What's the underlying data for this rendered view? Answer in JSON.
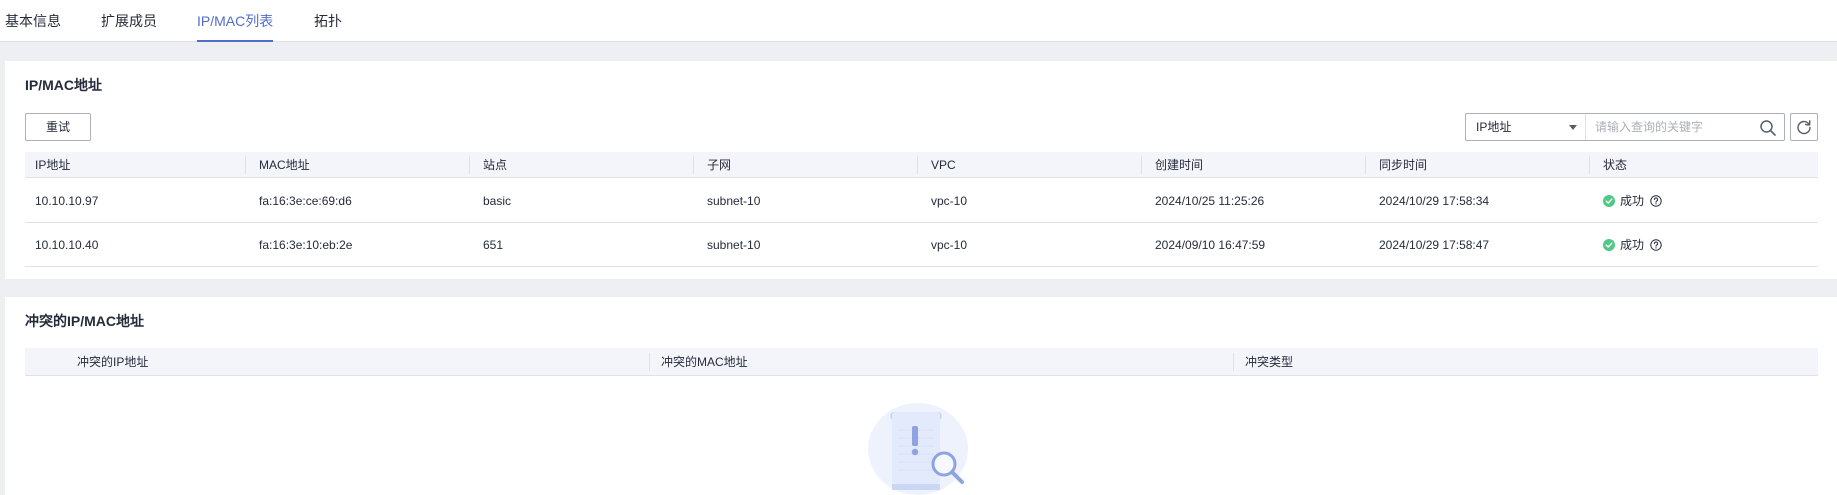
{
  "tabs": [
    {
      "label": "基本信息",
      "active": false
    },
    {
      "label": "扩展成员",
      "active": false
    },
    {
      "label": "IP/MAC列表",
      "active": true
    },
    {
      "label": "拓扑",
      "active": false
    }
  ],
  "ipmac": {
    "title": "IP/MAC地址",
    "retry_label": "重试",
    "search": {
      "selected_field": "IP地址",
      "placeholder": "请输入查询的关键字"
    },
    "columns": [
      "IP地址",
      "MAC地址",
      "站点",
      "子网",
      "VPC",
      "创建时间",
      "同步时间",
      "状态"
    ],
    "rows": [
      {
        "ip": "10.10.10.97",
        "mac": "fa:16:3e:ce:69:d6",
        "site": "basic",
        "subnet": "subnet-10",
        "vpc": "vpc-10",
        "created": "2024/10/25 11:25:26",
        "synced": "2024/10/29 17:58:34",
        "status": "成功"
      },
      {
        "ip": "10.10.10.40",
        "mac": "fa:16:3e:10:eb:2e",
        "site": "651",
        "subnet": "subnet-10",
        "vpc": "vpc-10",
        "created": "2024/09/10 16:47:59",
        "synced": "2024/10/29 17:58:47",
        "status": "成功"
      }
    ]
  },
  "conflict": {
    "title": "冲突的IP/MAC地址",
    "columns": [
      "冲突的IP地址",
      "冲突的MAC地址",
      "冲突类型"
    ]
  },
  "colors": {
    "accent": "#526ecc",
    "success": "#50c987",
    "header_bg": "#f3f5fa",
    "page_bg": "#eeeff3"
  },
  "icons": {
    "search": "search-icon",
    "refresh": "refresh-icon",
    "status_ok": "check-circle-icon",
    "help": "question-circle-icon",
    "caret": "caret-down-icon",
    "empty": "empty-search-illustration"
  }
}
